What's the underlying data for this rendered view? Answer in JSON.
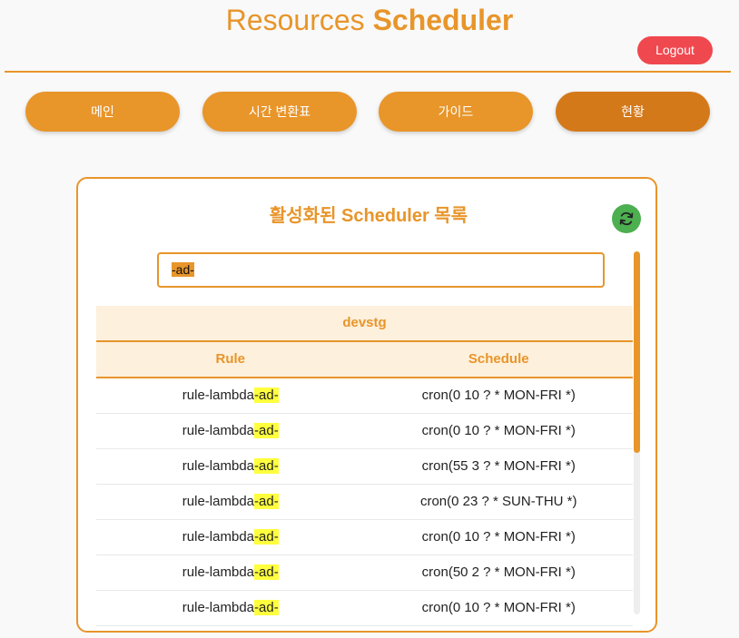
{
  "header": {
    "title_prefix": "Resources",
    "title_bold": "Scheduler",
    "logout_label": "Logout"
  },
  "nav": [
    {
      "label": "메인"
    },
    {
      "label": "시간 변환표"
    },
    {
      "label": "가이드"
    },
    {
      "label": "현황",
      "active": true
    }
  ],
  "panel": {
    "title": "활성화된 Scheduler 목록",
    "refresh_icon": "refresh-icon",
    "search_value": "-ad-",
    "group_name": "devstg",
    "columns": {
      "rule": "Rule",
      "schedule": "Schedule"
    },
    "rows": [
      {
        "rule_prefix": "rule-lambda",
        "rule_match": "-ad-",
        "schedule": "cron(0 10 ? * MON-FRI *)"
      },
      {
        "rule_prefix": "rule-lambda",
        "rule_match": "-ad-",
        "schedule": "cron(0 10 ? * MON-FRI *)"
      },
      {
        "rule_prefix": "rule-lambda",
        "rule_match": "-ad-",
        "schedule": "cron(55 3 ? * MON-FRI *)"
      },
      {
        "rule_prefix": "rule-lambda",
        "rule_match": "-ad-",
        "schedule": "cron(0 23 ? * SUN-THU *)"
      },
      {
        "rule_prefix": "rule-lambda",
        "rule_match": "-ad-",
        "schedule": "cron(0 10 ? * MON-FRI *)"
      },
      {
        "rule_prefix": "rule-lambda",
        "rule_match": "-ad-",
        "schedule": "cron(50 2 ? * MON-FRI *)"
      },
      {
        "rule_prefix": "rule-lambda",
        "rule_match": "-ad-",
        "schedule": "cron(0 10 ? * MON-FRI *)"
      }
    ]
  },
  "colors": {
    "accent": "#e8952a",
    "accent_dark": "#d4791a",
    "logout": "#f0484f",
    "refresh": "#4caf50",
    "highlight": "#ffff3d"
  }
}
